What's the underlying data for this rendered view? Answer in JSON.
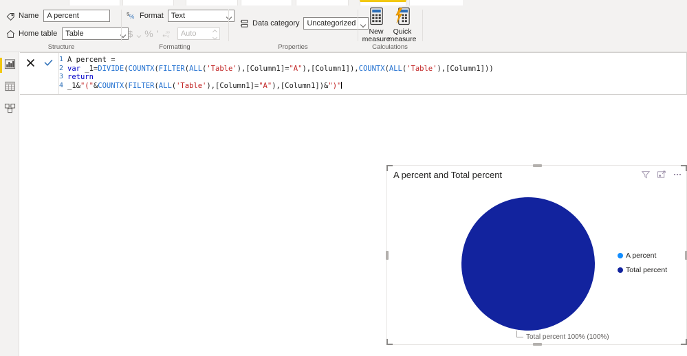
{
  "ribbon": {
    "tabs_visible_stub": true,
    "structure": {
      "group_label": "Structure",
      "name_icon": "tag-icon",
      "name_label": "Name",
      "name_value": "A percent",
      "home_table_icon": "home-icon",
      "home_table_label": "Home table",
      "home_table_value": "Table"
    },
    "formatting": {
      "group_label": "Formatting",
      "format_icon": "currency-percent-icon",
      "format_label": "Format",
      "format_value": "Text",
      "currency_icon": "dollar-icon",
      "currency_dropdown_icon": "chevron-down-icon",
      "percent_icon": "percent-icon",
      "comma_icon": "comma-icon",
      "decimal_icon": "decrease-decimals-icon",
      "decimals_placeholder": "Auto"
    },
    "properties": {
      "group_label": "Properties",
      "data_category_icon": "data-category-icon",
      "data_category_label": "Data category",
      "data_category_value": "Uncategorized"
    },
    "calculations": {
      "group_label": "Calculations",
      "new_measure_icon": "calculator-icon",
      "new_measure_line1": "New",
      "new_measure_line2": "measure",
      "quick_measure_icon": "quick-calculator-icon",
      "quick_measure_line1": "Quick",
      "quick_measure_line2": "measure"
    }
  },
  "leftnav": {
    "items": [
      {
        "name": "report-view",
        "icon": "report-chart-icon",
        "selected": true
      },
      {
        "name": "data-view",
        "icon": "table-grid-icon",
        "selected": false
      },
      {
        "name": "model-view",
        "icon": "model-relationships-icon",
        "selected": false
      }
    ]
  },
  "formula_bar": {
    "cancel_icon": "cancel-x-icon",
    "commit_icon": "commit-check-icon",
    "lines": [
      {
        "num": "1",
        "text": "A percent ="
      },
      {
        "num": "2",
        "text": "var _1=DIVIDE(COUNTX(FILTER(ALL('Table'),[Column1]=\"A\"),[Column1]),COUNTX(ALL('Table'),[Column1]))"
      },
      {
        "num": "3",
        "text": "return"
      },
      {
        "num": "4",
        "text": "_1&\"(\"&COUNTX(FILTER(ALL('Table'),[Column1]=\"A\"),[Column1])&\")\""
      }
    ]
  },
  "visual": {
    "title": "A percent and Total percent",
    "filter_icon": "filter-funnel-icon",
    "focus_icon": "focus-mode-icon",
    "more_icon": "more-options-icon",
    "callout_label": "Total percent 100% (100%)",
    "legend": [
      {
        "label": "A percent",
        "color": "#118DFF"
      },
      {
        "label": "Total percent",
        "color": "#12239E"
      }
    ]
  },
  "chart_data": {
    "type": "pie",
    "title": "A percent and Total percent",
    "labels": [
      "A percent",
      "Total percent"
    ],
    "values": [
      0,
      100
    ],
    "value_suffix": "%",
    "colors": [
      "#118DFF",
      "#12239E"
    ],
    "data_labels": [
      "",
      "Total percent 100% (100%)"
    ],
    "legend_position": "right",
    "grid": false
  },
  "colors": {
    "accent_yellow": "#F2C811",
    "ribbon_bg": "#F3F2F1",
    "pie_dark_blue": "#12239E",
    "pie_light_blue": "#118DFF",
    "text_primary": "#252423"
  }
}
